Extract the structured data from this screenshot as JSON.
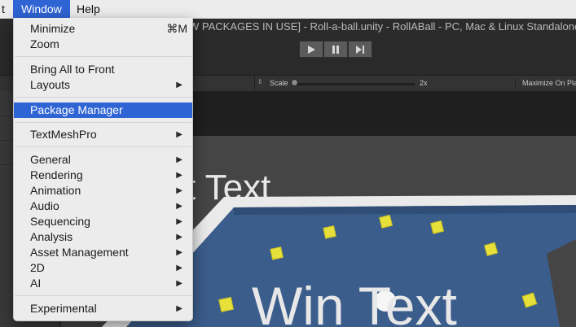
{
  "menubar": {
    "items": [
      {
        "label": "t"
      },
      {
        "label": "Window"
      },
      {
        "label": "Help"
      }
    ]
  },
  "unity": {
    "window_title": "W PACKAGES IN USE] - Roll-a-ball.unity - RollABall - PC, Mac & Linux Standalone",
    "scale_label": "Scale",
    "scale_value": "2x",
    "maximize_label": "Maximize On Play"
  },
  "game_view": {
    "overlay_text_top": "t Text",
    "overlay_text_bottom": "Win Text",
    "colors": {
      "floor": "#3b5d8c",
      "wall": "#eaeaea",
      "pickup": "#e8e03a",
      "background": "#454545"
    }
  },
  "window_menu": {
    "items": [
      {
        "label": "Minimize",
        "shortcut": "⌘M"
      },
      {
        "label": "Zoom"
      },
      {
        "label": "Bring All to Front"
      },
      {
        "label": "Layouts",
        "submenu": true
      },
      {
        "label": "Package Manager",
        "highlighted": true
      },
      {
        "label": "TextMeshPro",
        "submenu": true
      },
      {
        "label": "General",
        "submenu": true
      },
      {
        "label": "Rendering",
        "submenu": true
      },
      {
        "label": "Animation",
        "submenu": true
      },
      {
        "label": "Audio",
        "submenu": true
      },
      {
        "label": "Sequencing",
        "submenu": true
      },
      {
        "label": "Analysis",
        "submenu": true
      },
      {
        "label": "Asset Management",
        "submenu": true
      },
      {
        "label": "2D",
        "submenu": true
      },
      {
        "label": "AI",
        "submenu": true
      },
      {
        "label": "Experimental",
        "submenu": true
      }
    ],
    "submenu_glyph": "▶",
    "highlight_color": "#2f64d4"
  }
}
